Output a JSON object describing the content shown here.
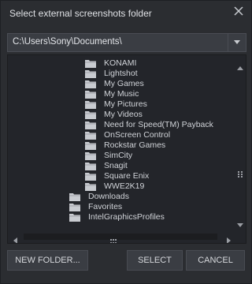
{
  "dialog": {
    "title": "Select external screenshots folder",
    "close_icon": "close-icon"
  },
  "path": {
    "value": "C:\\Users\\Sony\\Documents\\",
    "dropdown_icon": "chevron-down-icon"
  },
  "tree": {
    "items": [
      {
        "label": "KONAMI",
        "level": 2
      },
      {
        "label": "Lightshot",
        "level": 2
      },
      {
        "label": "My Games",
        "level": 2
      },
      {
        "label": "My Music",
        "level": 2
      },
      {
        "label": "My Pictures",
        "level": 2
      },
      {
        "label": "My Videos",
        "level": 2
      },
      {
        "label": "Need for Speed(TM) Payback",
        "level": 2
      },
      {
        "label": "OnScreen Control",
        "level": 2
      },
      {
        "label": "Rockstar Games",
        "level": 2
      },
      {
        "label": "SimCity",
        "level": 2
      },
      {
        "label": "Snagit",
        "level": 2
      },
      {
        "label": "Square Enix",
        "level": 2
      },
      {
        "label": "WWE2K19",
        "level": 2
      },
      {
        "label": "Downloads",
        "level": 1
      },
      {
        "label": "Favorites",
        "level": 1
      },
      {
        "label": "IntelGraphicsProfiles",
        "level": 1
      }
    ]
  },
  "buttons": {
    "new_folder": "NEW FOLDER...",
    "select": "SELECT",
    "cancel": "CANCEL"
  },
  "colors": {
    "folder": "#c8cbd0",
    "background": "#2b2d31"
  }
}
